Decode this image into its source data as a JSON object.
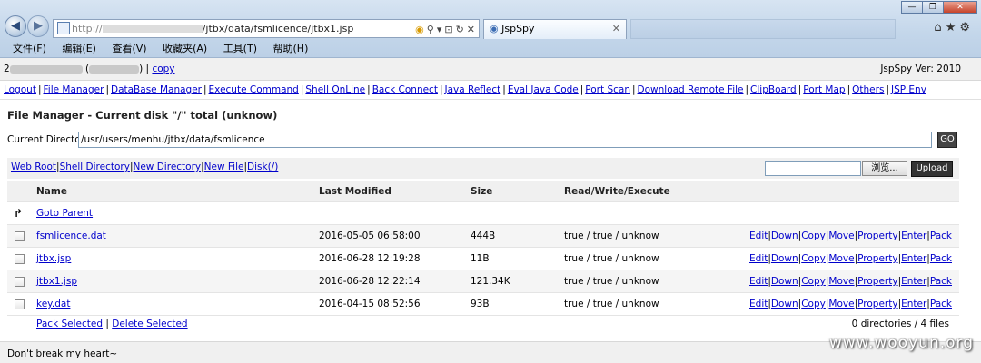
{
  "browser": {
    "address_prefix": "http://",
    "address_url": "/jtbx/data/fsmlicence/jtbx1.jsp",
    "tab_title": "JspSpy",
    "menu": [
      "文件(F)",
      "编辑(E)",
      "查看(V)",
      "收藏夹(A)",
      "工具(T)",
      "帮助(H)"
    ]
  },
  "topline": {
    "prefix": "2",
    "copy_link": "copy",
    "version": "JspSpy Ver: 2010"
  },
  "nav": [
    "Logout",
    "File Manager",
    "DataBase Manager",
    "Execute Command",
    "Shell OnLine",
    "Back Connect",
    "Java Reflect",
    "Eval Java Code",
    "Port Scan",
    "Download Remote File",
    "ClipBoard",
    "Port Map",
    "Others",
    "JSP Env"
  ],
  "file_manager": {
    "title": "File Manager - Current disk \"/\" total (unknow)",
    "current_dir_label": "Current Directory",
    "current_dir": "/usr/users/menhu/jtbx/data/fsmlicence",
    "go_label": "GO",
    "links": [
      "Web Root",
      "Shell Directory",
      "New Directory",
      "New File",
      "Disk(/)"
    ],
    "browse_label": "浏览...",
    "upload_label": "Upload",
    "columns": [
      "Name",
      "Last Modified",
      "Size",
      "Read/Write/Execute"
    ],
    "goto_parent": "Goto Parent",
    "files": [
      {
        "name": "fsmlicence.dat",
        "modified": "2016-05-05 06:58:00",
        "size": "444B",
        "rwx": "true / true / unknow"
      },
      {
        "name": "jtbx.jsp",
        "modified": "2016-06-28 12:19:28",
        "size": "11B",
        "rwx": "true / true / unknow"
      },
      {
        "name": "jtbx1.jsp",
        "modified": "2016-06-28 12:22:14",
        "size": "121.34K",
        "rwx": "true / true / unknow"
      },
      {
        "name": "key.dat",
        "modified": "2016-04-15 08:52:56",
        "size": "93B",
        "rwx": "true / true / unknow"
      }
    ],
    "actions": [
      "Edit",
      "Down",
      "Copy",
      "Move",
      "Property",
      "Enter",
      "Pack"
    ],
    "pack_selected": "Pack Selected",
    "delete_selected": "Delete Selected",
    "summary": "0 directories / 4 files"
  },
  "footer": "Don't break my heart~",
  "watermark": "www.wooyun.org"
}
